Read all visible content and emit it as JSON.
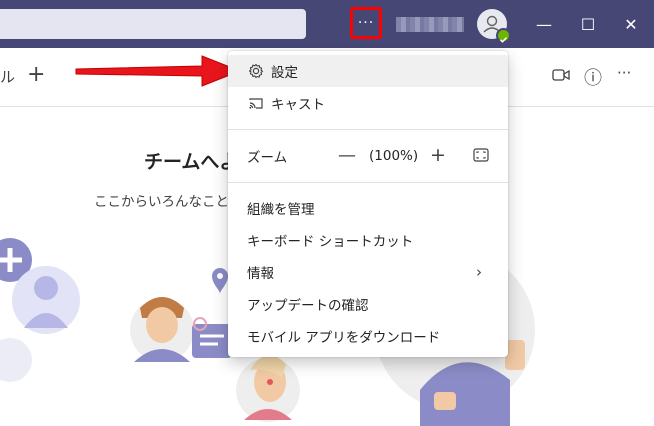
{
  "titlebar": {
    "more_glyph": "···",
    "window_controls": {
      "minimize": "—",
      "maximize": "☐",
      "close": "✕"
    }
  },
  "subbar": {
    "partial_tab_text": "ル",
    "add_glyph": "+",
    "tools": {
      "info_glyph": "ⓘ",
      "more_glyph": "···"
    }
  },
  "welcome": {
    "title": "チームへよ",
    "subtitle": "ここからいろんなこと"
  },
  "menu": {
    "items": [
      {
        "label": "設定",
        "icon": "gear-icon",
        "highlighted": true
      },
      {
        "label": "キャスト",
        "icon": "cast-icon"
      }
    ],
    "zoom": {
      "label": "ズーム",
      "minus": "—",
      "value": "(100%)",
      "plus": "+"
    },
    "items2": [
      {
        "label": "組織を管理"
      },
      {
        "label": "キーボード ショートカット"
      },
      {
        "label": "情報",
        "has_submenu": true,
        "chevron": "›"
      },
      {
        "label": "アップデートの確認"
      },
      {
        "label": "モバイル アプリをダウンロード"
      }
    ]
  },
  "colors": {
    "titlebar": "#464775",
    "highlight_box": "#ff0000",
    "arrow": "#e8161c",
    "presence": "#6bb700",
    "illustration_purple": "#8b8cc7"
  }
}
